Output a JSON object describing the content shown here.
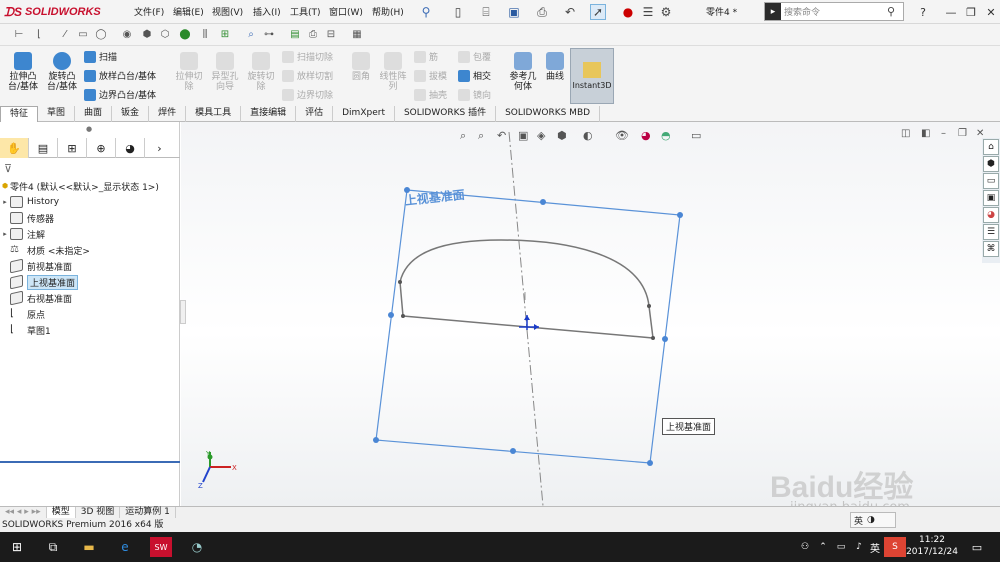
{
  "app": {
    "name": "SOLIDWORKS",
    "document_title": "零件4 *"
  },
  "menu": [
    "文件(F)",
    "编辑(E)",
    "视图(V)",
    "插入(I)",
    "工具(T)",
    "窗口(W)",
    "帮助(H)"
  ],
  "search": {
    "placeholder": "搜索命令"
  },
  "commands": {
    "extrude_boss": "拉伸凸\n台/基体",
    "revolve_boss": "旋转凸\n台/基体",
    "sweep": "扫描",
    "loft_boss": "放样凸台/基体",
    "boundary_boss": "边界凸台/基体",
    "extrude_cut": "拉伸切\n除",
    "hole_wizard": "异型孔\n向导",
    "revolve_cut": "旋转切\n除",
    "sweep_cut": "扫描切除",
    "loft_cut": "放样切割",
    "boundary_cut": "边界切除",
    "fillet": "圆角",
    "linear_pattern": "线性阵\n列",
    "rib": "筋",
    "draft": "拔模",
    "shell": "抽壳",
    "wrap": "包覆",
    "intersect": "相交",
    "mirror": "镜向",
    "ref_geometry": "参考几\n何体",
    "curves": "曲线",
    "instant3d": "Instant3D"
  },
  "tabs": [
    "特征",
    "草图",
    "曲面",
    "钣金",
    "焊件",
    "模具工具",
    "直接编辑",
    "评估",
    "DimXpert",
    "SOLIDWORKS 插件",
    "SOLIDWORKS MBD"
  ],
  "active_tab": "特征",
  "tree": {
    "root": "零件4 (默认<<默认>_显示状态 1>)",
    "items": [
      {
        "label": "History",
        "expandable": true
      },
      {
        "label": "传感器",
        "expandable": false
      },
      {
        "label": "注解",
        "expandable": true
      },
      {
        "label": "材质 <未指定>",
        "expandable": false
      },
      {
        "label": "前视基准面",
        "expandable": false
      },
      {
        "label": "上视基准面",
        "expandable": false,
        "selected": true
      },
      {
        "label": "右视基准面",
        "expandable": false
      },
      {
        "label": "原点",
        "expandable": false
      },
      {
        "label": "草图1",
        "expandable": false
      }
    ]
  },
  "graphics": {
    "plane_label": "上视基准面",
    "tooltip": "上视基准面"
  },
  "bottom_tabs": [
    "模型",
    "3D 视图",
    "运动算例 1"
  ],
  "status": "SOLIDWORKS Premium 2016 x64 版",
  "taskbar": {
    "ime": "英",
    "time": "11:22",
    "date": "2017/12/24"
  },
  "watermark": {
    "text": "Baidu经验",
    "sub": "jingyan.baidu.com"
  },
  "colors": {
    "accent": "#3b6bb5",
    "plane": "#5a92d8",
    "brand": "#c8102e"
  }
}
